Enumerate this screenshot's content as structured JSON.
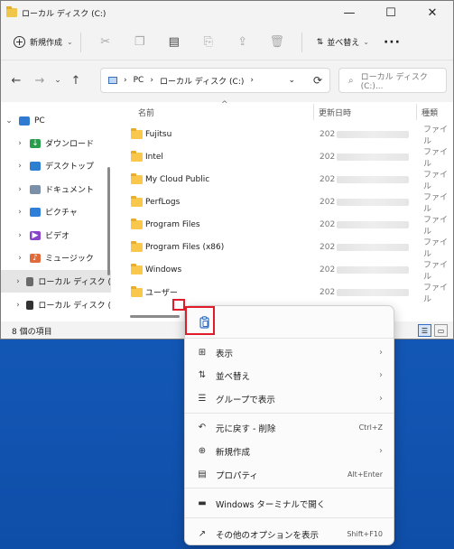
{
  "window": {
    "title": "ローカル ディスク (C:)",
    "controls": {
      "minimize": "—",
      "maximize": "☐",
      "close": "✕"
    }
  },
  "toolbar": {
    "new_label": "新規作成",
    "sort_label": "並べ替え",
    "more_label": "···",
    "icons": [
      "cut-icon",
      "copy-icon",
      "paste-icon",
      "rename-icon",
      "share-icon",
      "delete-icon"
    ]
  },
  "address": {
    "back": "←",
    "forward": "→",
    "recent": "⌄",
    "up": "↑",
    "parts": [
      "PC",
      "ローカル ディスク (C:)"
    ],
    "sep": "›",
    "dropdown": "⌄",
    "refresh": "⟳",
    "search_placeholder": "ローカル ディスク (C:)..."
  },
  "sidebar": {
    "items": [
      {
        "label": "PC",
        "chevron": "⌄",
        "indent": 0,
        "color": "#2e7bd1",
        "glyph": ""
      },
      {
        "label": "ダウンロード",
        "chevron": "›",
        "indent": 1,
        "color": "#2a9d4d",
        "glyph": "↓"
      },
      {
        "label": "デスクトップ",
        "chevron": "›",
        "indent": 1,
        "color": "#2d7fd1",
        "glyph": ""
      },
      {
        "label": "ドキュメント",
        "chevron": "›",
        "indent": 1,
        "color": "#7a8fa8",
        "glyph": ""
      },
      {
        "label": "ピクチャ",
        "chevron": "›",
        "indent": 1,
        "color": "#2f7fd8",
        "glyph": ""
      },
      {
        "label": "ビデオ",
        "chevron": "›",
        "indent": 1,
        "color": "#8a44c9",
        "glyph": "▶"
      },
      {
        "label": "ミュージック",
        "chevron": "›",
        "indent": 1,
        "color": "#e06a3a",
        "glyph": "♪"
      },
      {
        "label": "ローカル ディスク (",
        "chevron": "›",
        "indent": 1,
        "color": "#6a6a6a",
        "glyph": "",
        "selected": true
      },
      {
        "label": "ローカル ディスク (",
        "chevron": "›",
        "indent": 1,
        "color": "#333333",
        "glyph": ""
      }
    ]
  },
  "columns": {
    "name": "名前",
    "date": "更新日時",
    "type": "種類"
  },
  "files": [
    {
      "name": "Fujitsu",
      "date": "202",
      "type": "ファイル"
    },
    {
      "name": "Intel",
      "date": "202",
      "type": "ファイル"
    },
    {
      "name": "My Cloud Public",
      "date": "202",
      "type": "ファイル"
    },
    {
      "name": "PerfLogs",
      "date": "202",
      "type": "ファイル"
    },
    {
      "name": "Program Files",
      "date": "202",
      "type": "ファイル"
    },
    {
      "name": "Program Files (x86)",
      "date": "202",
      "type": "ファイル"
    },
    {
      "name": "Windows",
      "date": "202",
      "type": "ファイル"
    },
    {
      "name": "ユーザー",
      "date": "202",
      "type": "ファイル"
    }
  ],
  "status": {
    "item_count": "8 個の項目"
  },
  "context_menu": {
    "items": [
      {
        "label": "表示",
        "icon": "⊞",
        "icon_name": "view-icon",
        "submenu": true,
        "shortcut": ""
      },
      {
        "label": "並べ替え",
        "icon": "⇅",
        "icon_name": "sort-icon",
        "submenu": true,
        "shortcut": ""
      },
      {
        "label": "グループで表示",
        "icon": "☰",
        "icon_name": "group-icon",
        "submenu": true,
        "shortcut": ""
      },
      {
        "label": "元に戻す - 削除",
        "icon": "↶",
        "icon_name": "undo-icon",
        "submenu": false,
        "shortcut": "Ctrl+Z"
      },
      {
        "label": "新規作成",
        "icon": "⊕",
        "icon_name": "new-icon",
        "submenu": true,
        "shortcut": ""
      },
      {
        "label": "プロパティ",
        "icon": "▤",
        "icon_name": "properties-icon",
        "submenu": false,
        "shortcut": "Alt+Enter"
      },
      {
        "label": "Windows ターミナルで開く",
        "icon": "▬",
        "icon_name": "terminal-icon",
        "submenu": false,
        "shortcut": ""
      },
      {
        "label": "その他のオプションを表示",
        "icon": "↗",
        "icon_name": "more-options-icon",
        "submenu": false,
        "shortcut": "Shift+F10"
      }
    ],
    "paste_icon": "📋",
    "submenu_arrow": "›"
  },
  "highlight_color": "#e21b2b"
}
